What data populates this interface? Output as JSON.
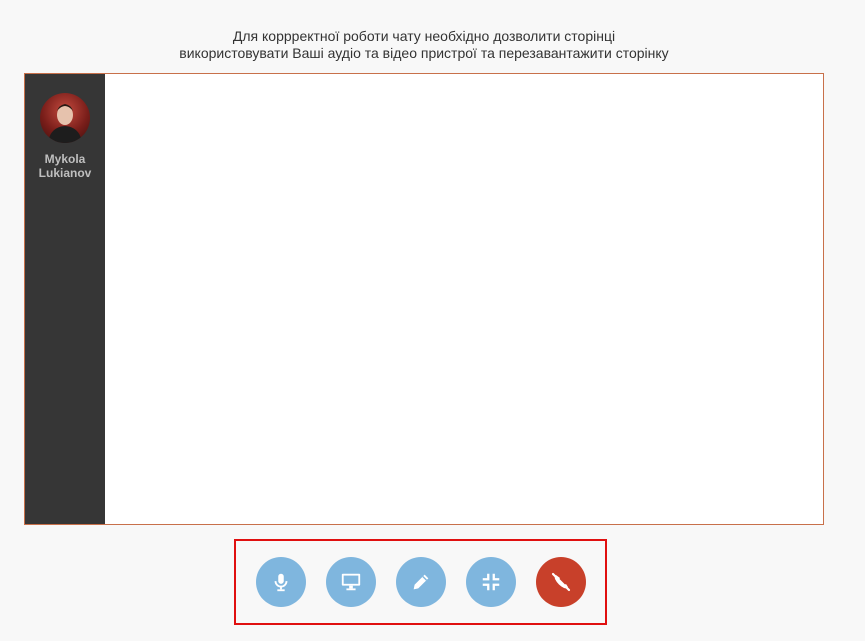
{
  "notice": {
    "line1": "Для коррректної роботи чату необхідно дозволити сторінці",
    "line2": "використовувати Ваші аудіо та відео пристрої та перезавантажити сторінку"
  },
  "participants": [
    {
      "first_name": "Mykola",
      "last_name": "Lukianov",
      "avatar_icon": "user-photo"
    }
  ],
  "controls": [
    {
      "id": "mic",
      "icon": "microphone-icon",
      "color": "#7fb6de"
    },
    {
      "id": "screen",
      "icon": "monitor-icon",
      "color": "#7fb6de"
    },
    {
      "id": "draw",
      "icon": "pencil-icon",
      "color": "#7fb6de"
    },
    {
      "id": "minimize",
      "icon": "compress-icon",
      "color": "#7fb6de"
    },
    {
      "id": "hangup",
      "icon": "phone-hangup-icon",
      "color": "#c8402a"
    }
  ],
  "colors": {
    "frame_border": "#c8704a",
    "sidebar_bg": "#363636",
    "highlight_border": "#e01010"
  }
}
